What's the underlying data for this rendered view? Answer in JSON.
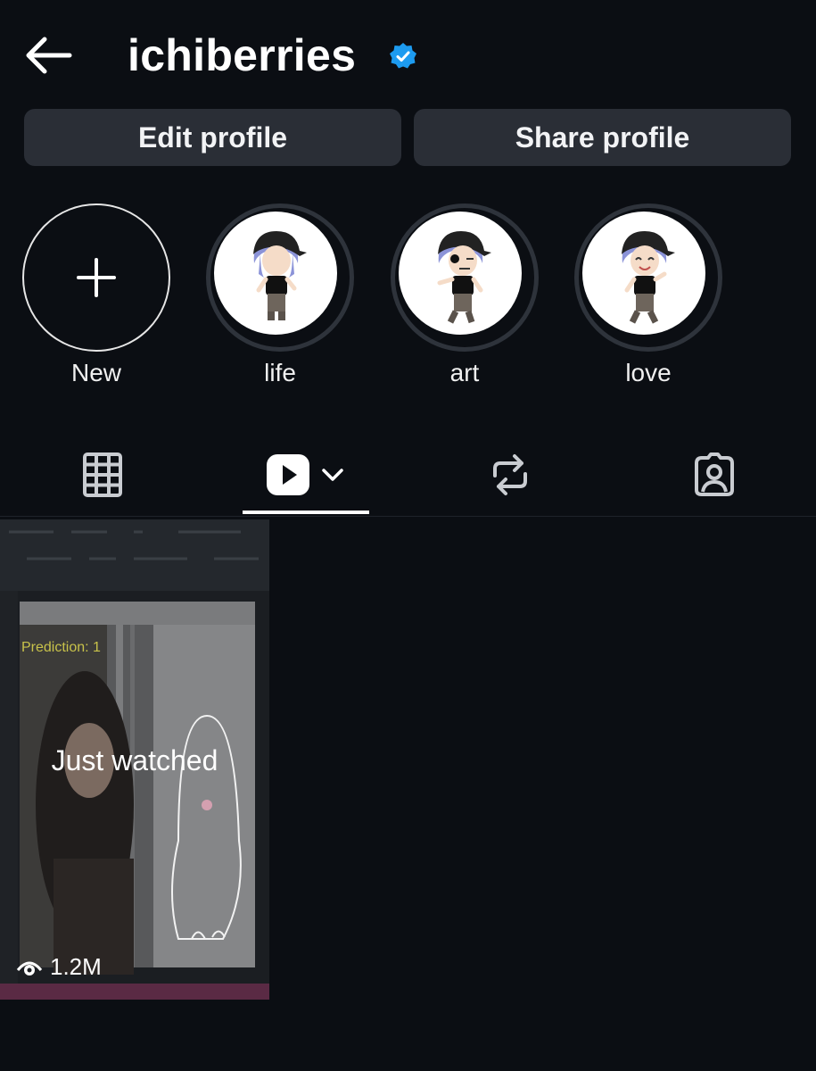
{
  "header": {
    "username": "ichiberries",
    "back_icon": "arrow-left-icon",
    "verified_icon": "verified-badge-icon",
    "verified_color": "#1d9bf0"
  },
  "actions": {
    "edit_label": "Edit profile",
    "share_label": "Share profile"
  },
  "highlights": [
    {
      "label": "New",
      "icon": "plus-icon"
    },
    {
      "label": "life"
    },
    {
      "label": "art"
    },
    {
      "label": "love"
    }
  ],
  "tabs": [
    {
      "icon": "grid-icon",
      "active": false
    },
    {
      "icon": "reels-play-icon",
      "active": true,
      "has_dropdown": true
    },
    {
      "icon": "repost-icon",
      "active": false
    },
    {
      "icon": "tagged-person-icon",
      "active": false
    }
  ],
  "reels": [
    {
      "caption": "Just watched",
      "views": "1.2M",
      "views_icon": "eye-icon"
    }
  ],
  "colors": {
    "background": "#0b0e13",
    "button": "#2a2e36",
    "ring": "#2e333b"
  }
}
